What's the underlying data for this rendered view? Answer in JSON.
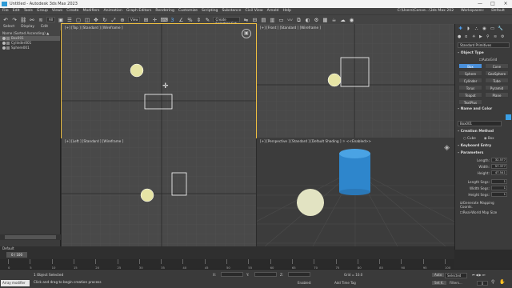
{
  "window": {
    "title": "Untitled - Autodesk 3ds Max 2023",
    "controls": [
      "—",
      "□",
      "×"
    ]
  },
  "menu": [
    "File",
    "Edit",
    "Tools",
    "Group",
    "Views",
    "Create",
    "Modifiers",
    "Animation",
    "Graph Editors",
    "Rendering",
    "Customize",
    "Scripting",
    "Substance",
    "Civil View",
    "Arnold",
    "Help"
  ],
  "menu_right": {
    "path": "C:\\Users\\Conve...\\3ds Max 202",
    "workspace_label": "Workspaces:",
    "workspace_value": "Default"
  },
  "toolbar": {
    "filter": "All",
    "view": "View",
    "selection_set": "Create Selection Set"
  },
  "explorer": {
    "tabs": [
      "Select",
      "Display",
      "Edit"
    ],
    "header": "Name (Sorted Ascending) ▲ Frozen",
    "items": [
      "Box001",
      "Cylinder001",
      "Sphere001"
    ]
  },
  "viewports": {
    "top": "[+] [Top ] [Standard ] [Wireframe ]",
    "front": "[+] [Front ] [Standard ] [Wireframe ]",
    "left": "[+] [Left ] [Standard ] [Wireframe ]",
    "persp": "[+] [Perspective ] [Standard ] [Default Shading ]  ☼ <<Enabled>>"
  },
  "command": {
    "category": "Standard Primitives",
    "object_type": "Object Type",
    "autogrid": "AutoGrid",
    "buttons": [
      "Box",
      "Cone",
      "Sphere",
      "GeoSphere",
      "Cylinder",
      "Tube",
      "Torus",
      "Pyramid",
      "Teapot",
      "Plane",
      "TextPlus"
    ],
    "name_color": "Name and Color",
    "name_value": "Box001",
    "creation_method": "Creation Method",
    "cube": "Cube",
    "box": "Box",
    "keyboard_entry": "Keyboard Entry",
    "parameters": "Parameters",
    "length_label": "Length:",
    "length": "32.577",
    "width_label": "Width:",
    "width": "57.377",
    "height_label": "Height:",
    "height": "47.541",
    "lsegs_label": "Length Segs:",
    "lsegs": "1",
    "wsegs_label": "Width Segs:",
    "wsegs": "1",
    "hsegs_label": "Height Segs:",
    "hsegs": "1",
    "gen_map": "Generate Mapping Coords.",
    "real_world": "Real-World Map Size",
    "swatch_color": "#3aa0e6"
  },
  "timeline": {
    "layer": "Default",
    "frame_box": "0 / 100",
    "ticks": [
      "0",
      "5",
      "10",
      "15",
      "20",
      "25",
      "30",
      "35",
      "40",
      "45",
      "50",
      "55",
      "60",
      "65",
      "70",
      "75",
      "80",
      "85",
      "90",
      "95",
      "100"
    ]
  },
  "status": {
    "maxscript": "Array modifier",
    "line1": "1 Object Selected",
    "line2": "Click and drag to begin creation process",
    "x_label": "X:",
    "y_label": "Y:",
    "z_label": "Z:",
    "grid": "Grid = 10.0",
    "auto": "Auto",
    "set_key": "Set K.",
    "selected": "Selected",
    "filters": "Filters...",
    "enabled": "Enabled:",
    "add_time_tag": "Add Time Tag",
    "frame": "0"
  },
  "colors": {
    "accent": "#4a8fd9",
    "cylinder": "#2e86cc",
    "sphere": "#e2e3c2",
    "active_border": "#f0c040"
  }
}
